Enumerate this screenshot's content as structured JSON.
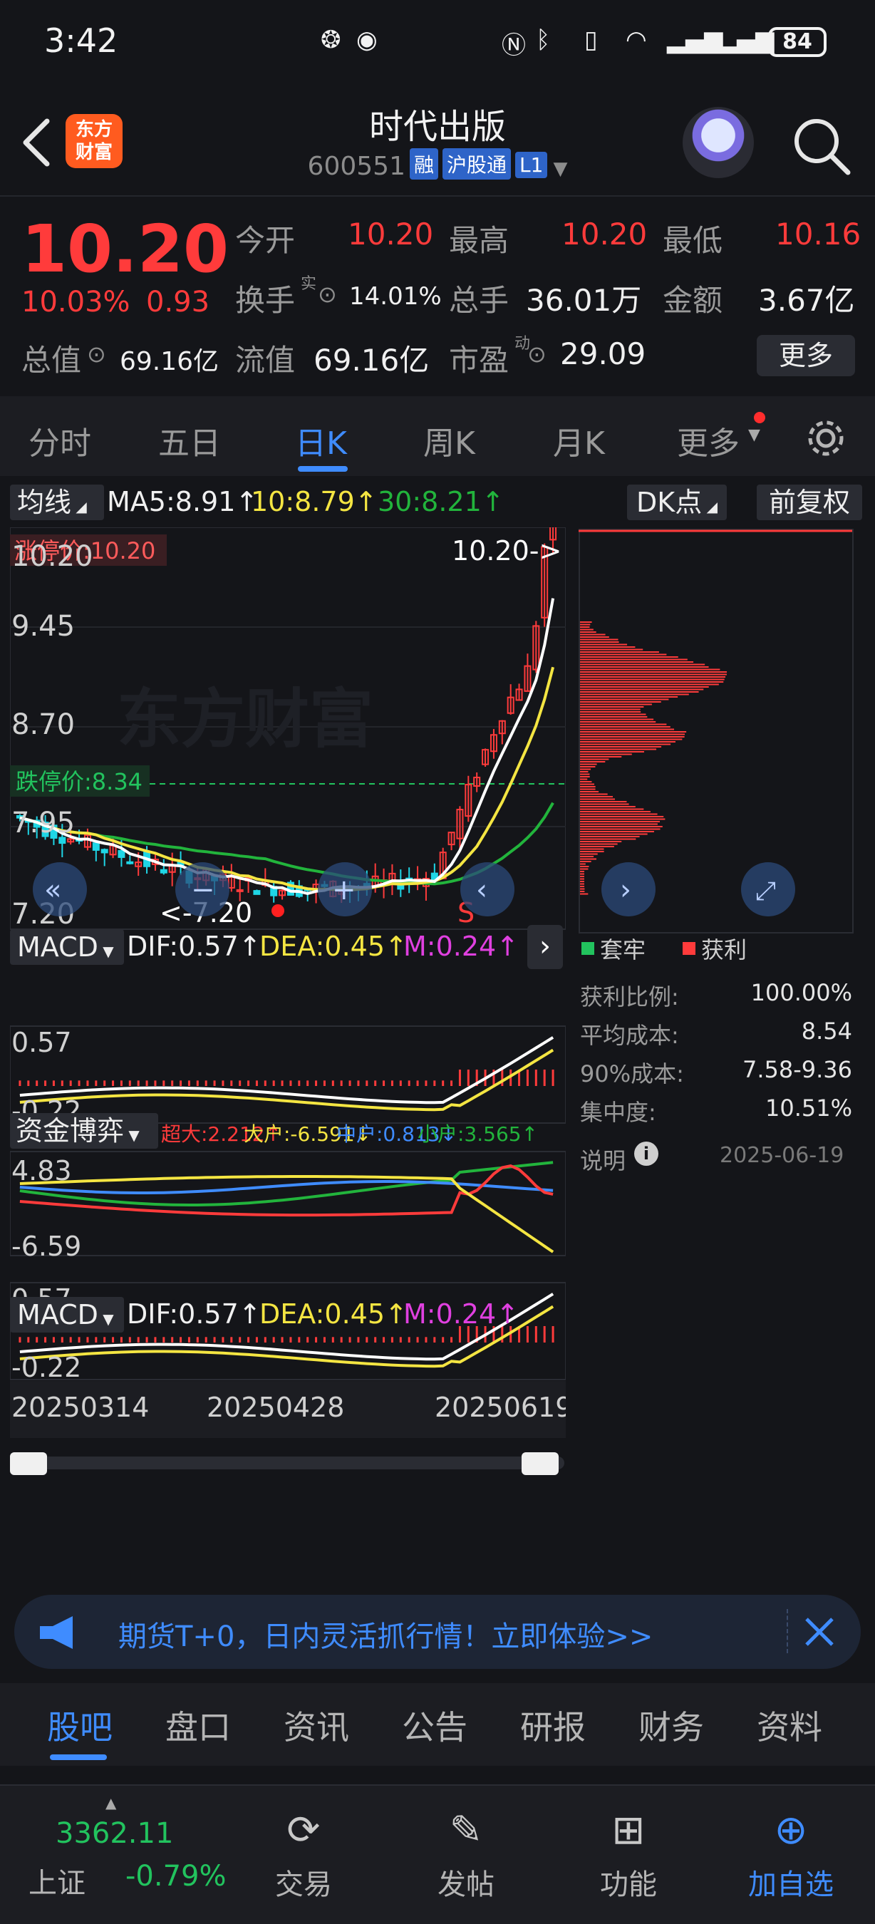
{
  "status_bar": {
    "time": "3:42",
    "battery": "84"
  },
  "header": {
    "logo_line1": "东方",
    "logo_line2": "财富",
    "stock_name": "时代出版",
    "stock_code": "600551",
    "tags": [
      "融",
      "沪股通",
      "L1"
    ]
  },
  "quote": {
    "price": "10.20",
    "change_pct": "10.03%",
    "change_val": "0.93",
    "fields": {
      "open_label": "今开",
      "open": "10.20",
      "high_label": "最高",
      "high": "10.20",
      "low_label": "最低",
      "low": "10.16",
      "turnover_label": "换手",
      "turnover_sup": "实",
      "turnover": "14.01%",
      "volume_label": "总手",
      "volume": "36.01万",
      "amount_label": "金额",
      "amount": "3.67亿",
      "mktcap_label": "总值",
      "mktcap": "69.16亿",
      "float_label": "流值",
      "float": "69.16亿",
      "pe_label": "市盈",
      "pe_sup": "动",
      "pe": "29.09"
    },
    "more_label": "更多"
  },
  "period_tabs": [
    "分时",
    "五日",
    "日K",
    "周K",
    "月K",
    "更多"
  ],
  "kline": {
    "ma_selector": "均线",
    "ma5": "MA5:8.91↑",
    "ma10": "10:8.79↑",
    "ma30": "30:8.21↑",
    "dk_label": "DK点",
    "adjust_label": "前复权",
    "y_labels": [
      "10.20",
      "9.45",
      "8.70",
      "7.95",
      "7.20"
    ],
    "limit_up_tag": "涨停价:10.20",
    "limit_down_tag": "跌停价:8.34",
    "last_price_arrow": "10.20->",
    "low_marker": "<-7.20",
    "sell_marker": "S",
    "watermark": "东方财富"
  },
  "macd1": {
    "name": "MACD",
    "dif": "DIF:0.57↑",
    "dea": "DEA:0.45↑",
    "m": "M:0.24↑",
    "y_top": "0.57",
    "y_bottom": "-0.22"
  },
  "fund": {
    "name": "资金博弈",
    "super": "超大:2.212↑",
    "big": "大户:-6.591↓",
    "mid": "中户:0.813↓",
    "small": "小户:3.565↑",
    "y_top": "4.83",
    "y_bottom": "-6.59"
  },
  "macd2": {
    "name": "MACD",
    "dif": "DIF:0.57↑",
    "dea": "DEA:0.45↑",
    "m": "M:0.24↑",
    "y_top": "0.57",
    "y_bottom": "-0.22"
  },
  "x_axis": [
    "20250314",
    "20250428",
    "20250619"
  ],
  "chips": {
    "legend_trapped": "套牢",
    "legend_profit": "获利",
    "rows": [
      {
        "label": "获利比例:",
        "value": "100.00%"
      },
      {
        "label": "平均成本:",
        "value": "8.54"
      },
      {
        "label": "90%成本:",
        "value": "7.58-9.36"
      },
      {
        "label": "集中度:",
        "value": "10.51%"
      }
    ],
    "note_label": "说明",
    "date": "2025-06-19"
  },
  "banner": {
    "text": "期货T+0，日内灵活抓行情！立即体验>>"
  },
  "section_tabs": [
    "股吧",
    "盘口",
    "资讯",
    "公告",
    "研报",
    "财务",
    "资料"
  ],
  "bottom_nav": {
    "index_value": "3362.11",
    "index_name": "上证",
    "index_change": "-0.79%",
    "items": [
      "交易",
      "发帖",
      "功能",
      "加自选"
    ]
  },
  "colors": {
    "up": "#ff3b3b",
    "down": "#22c35e",
    "accent": "#3f8cff",
    "ma5": "#ffffff",
    "ma10": "#f4e542",
    "ma30": "#22b43c"
  }
}
